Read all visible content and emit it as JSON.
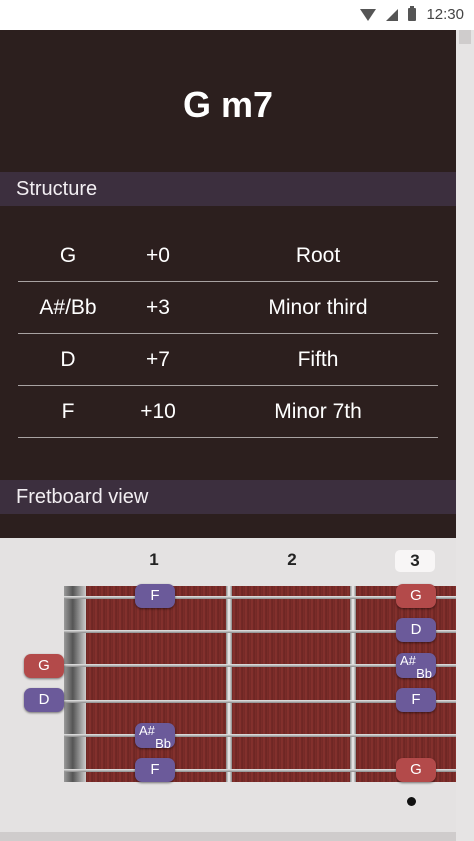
{
  "status_bar": {
    "time": "12:30"
  },
  "chord": {
    "title": "G m7"
  },
  "sections": {
    "structure": "Structure",
    "fretboard": "Fretboard view"
  },
  "structure": [
    {
      "note": "G",
      "interval": "+0",
      "name": "Root"
    },
    {
      "note": "A#/Bb",
      "interval": "+3",
      "name": "Minor third"
    },
    {
      "note": "D",
      "interval": "+7",
      "name": "Fifth"
    },
    {
      "note": "F",
      "interval": "+10",
      "name": "Minor 7th"
    }
  ],
  "fretboard": {
    "fret_numbers": [
      "1",
      "2",
      "3"
    ],
    "active_fret": "3",
    "open_notes": {
      "g": "G",
      "d": "D"
    },
    "fret1": {
      "top": "F",
      "sharp_a": "A#",
      "sharp_b": "Bb",
      "bottom": "F"
    },
    "fret3": {
      "s1": "G",
      "s2": "D",
      "sharp_a": "A#",
      "sharp_b": "Bb",
      "s4": "F",
      "s6": "G"
    }
  },
  "colors": {
    "root": "#b34a4a",
    "other": "#6b5a9a",
    "background": "#2c1f1e",
    "section": "#3c2f3e"
  },
  "icons": [
    "wifi-icon",
    "signal-icon",
    "battery-icon"
  ]
}
